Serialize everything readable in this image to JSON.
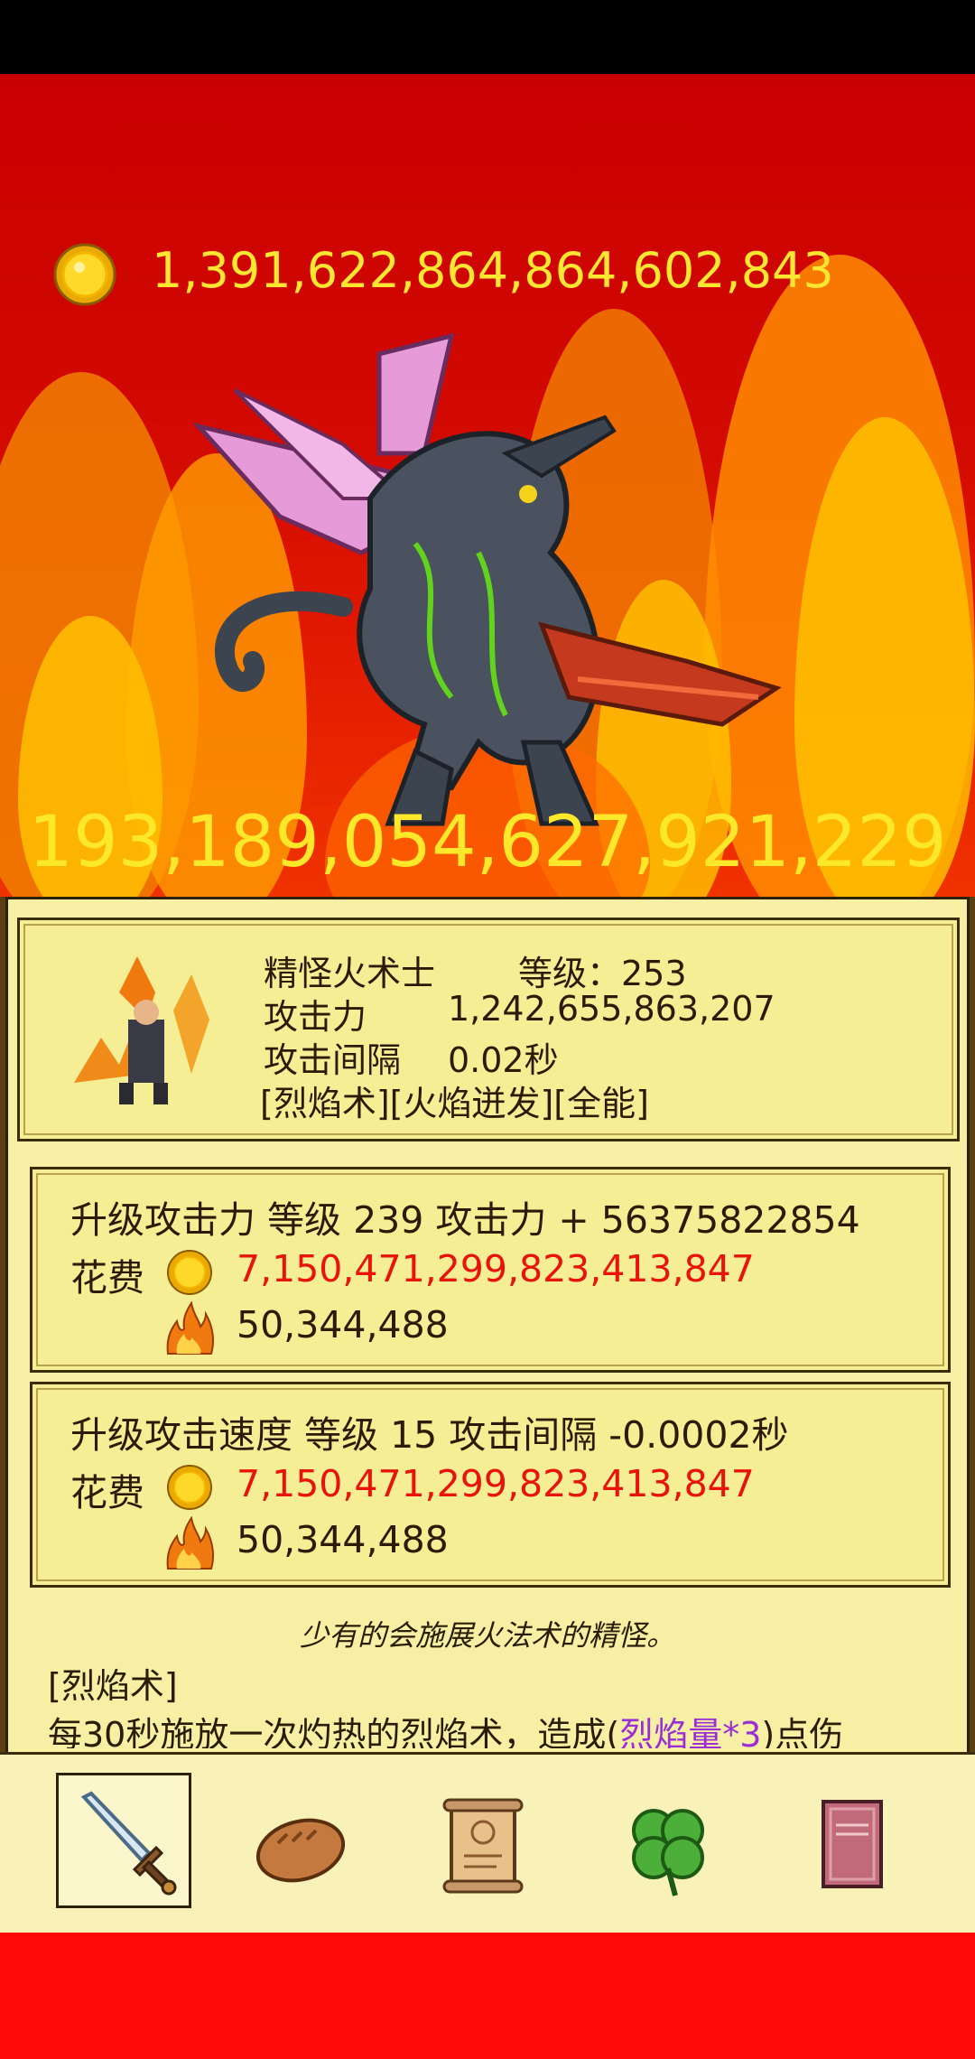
{
  "status": {
    "gold": "1,391,622,864,864,602,843"
  },
  "monster": {
    "hp": "193,189,054,627,921,229"
  },
  "hero": {
    "name": "精怪火术士",
    "level_label": "等级：253",
    "attack_label": "攻击力",
    "attack_value": "1,242,655,863,207",
    "interval_label": "攻击间隔",
    "interval_value": "0.02秒",
    "skills": "[烈焰术][火焰迸发][全能]"
  },
  "upgrades": [
    {
      "title": "升级攻击力 等级 239   攻击力 + 56375822854",
      "cost_label": "花费",
      "gold_cost": "7,150,471,299,823,413,847",
      "flame_cost": "50,344,488"
    },
    {
      "title": "升级攻击速度 等级 15 攻击间隔 -0.0002秒",
      "cost_label": "花费",
      "gold_cost": "7,150,471,299,823,413,847",
      "flame_cost": "50,344,488"
    }
  ],
  "description": {
    "flavor": "少有的会施展火法术的精怪。",
    "skill_title": "[烈焰术]",
    "skill_text_before": "每30秒施放一次灼热的烈焰术，造成(",
    "skill_text_highlight": "烈焰量*3",
    "skill_text_after": ")点伤"
  },
  "nav": {
    "tabs": [
      {
        "icon": "sword-icon",
        "selected": true
      },
      {
        "icon": "bread-icon",
        "selected": false
      },
      {
        "icon": "scroll-icon",
        "selected": false
      },
      {
        "icon": "clover-icon",
        "selected": false
      },
      {
        "icon": "book-icon",
        "selected": false
      }
    ]
  },
  "colors": {
    "gold_text": "#ffe630",
    "cost_red": "#e8140c",
    "highlight_purple": "#9a2fd6",
    "panel_bg": "#f6efa4"
  }
}
